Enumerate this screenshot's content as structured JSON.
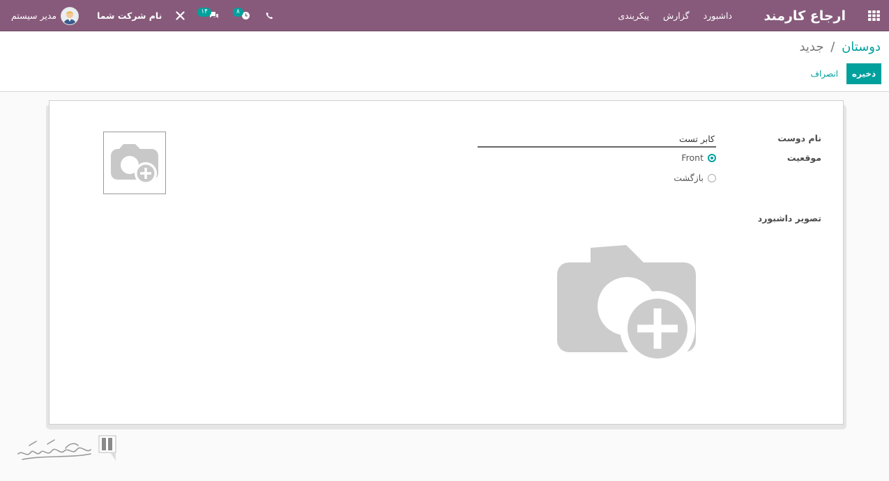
{
  "navbar": {
    "app_title": "ارجاع کارمند",
    "menu": [
      "داشبورد",
      "گزارش",
      "پیکربندی"
    ],
    "user_name": "مدیر سیستم",
    "company_name": "نام شرکت شما",
    "messages_count": "۱۴",
    "activities_count": "۸",
    "bg_color": "#875a7b"
  },
  "breadcrumb": {
    "parent": "دوستان",
    "separator": "/",
    "current": "جدید"
  },
  "buttons": {
    "save": "ذخیره",
    "discard": "انصراف"
  },
  "form": {
    "friend_name_label": "نام دوست",
    "friend_name_value": "کابر تست",
    "position_label": "موقعیت",
    "position_options": [
      "Front",
      "بازگشت"
    ],
    "position_selected": "Front",
    "dashboard_image_label": "تصویر داشبورد"
  },
  "icons": [
    "apps-grid-icon",
    "phone-icon",
    "activity-clock-icon",
    "messages-icon",
    "debug-tools-icon",
    "camera-add-icon"
  ],
  "accent_color": "#00a09d"
}
